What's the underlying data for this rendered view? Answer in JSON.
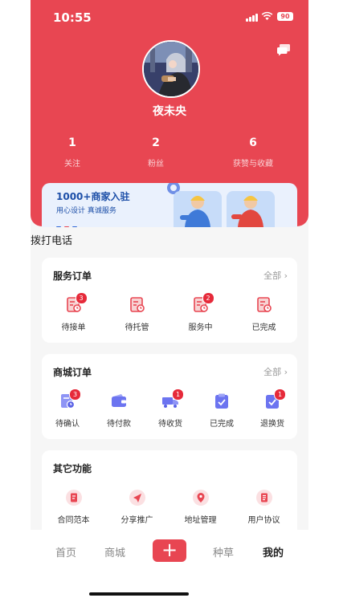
{
  "status_bar": {
    "time": "10:55",
    "battery": "90"
  },
  "profile": {
    "username": "夜未央",
    "stats": [
      {
        "value": "1",
        "label": "关注"
      },
      {
        "value": "2",
        "label": "粉丝"
      },
      {
        "value": "6",
        "label": "获赞与收藏"
      }
    ]
  },
  "banner": {
    "title": "1000+商家入驻",
    "subtitle": "用心设计 真诚服务",
    "dot_colors": [
      "#2f66d6",
      "#e84652",
      "#2f66d6"
    ]
  },
  "dial_label": "拨打电话",
  "service_orders": {
    "title": "服务订单",
    "all_label": "全部",
    "items": [
      {
        "label": "待接单",
        "badge": "3",
        "icon": "order-pending-icon"
      },
      {
        "label": "待托管",
        "badge": "",
        "icon": "order-escrow-icon"
      },
      {
        "label": "服务中",
        "badge": "2",
        "icon": "order-in-service-icon"
      },
      {
        "label": "已完成",
        "badge": "",
        "icon": "order-complete-icon"
      }
    ]
  },
  "mall_orders": {
    "title": "商城订单",
    "all_label": "全部",
    "items": [
      {
        "label": "待确认",
        "badge": "3",
        "icon": "clock-doc-icon"
      },
      {
        "label": "待付款",
        "badge": "",
        "icon": "wallet-icon"
      },
      {
        "label": "待收货",
        "badge": "1",
        "icon": "truck-icon"
      },
      {
        "label": "已完成",
        "badge": "",
        "icon": "check-clipboard-icon"
      },
      {
        "label": "退换货",
        "badge": "1",
        "icon": "return-icon"
      }
    ]
  },
  "other_functions": {
    "title": "其它功能",
    "items": [
      {
        "label": "合同范本",
        "icon": "contract-icon"
      },
      {
        "label": "分享推广",
        "icon": "share-icon"
      },
      {
        "label": "地址管理",
        "icon": "location-icon"
      },
      {
        "label": "用户协议",
        "icon": "agreement-icon"
      }
    ]
  },
  "tab_bar": {
    "tabs": [
      {
        "label": "首页"
      },
      {
        "label": "商城"
      },
      {
        "label": "种草"
      },
      {
        "label": "我的"
      }
    ],
    "add_label": "+"
  },
  "colors": {
    "brand_red": "#e84652",
    "badge_red": "#e62a3a",
    "mall_icon": "#6c74f0",
    "banner_blue": "#1d4fa8"
  }
}
